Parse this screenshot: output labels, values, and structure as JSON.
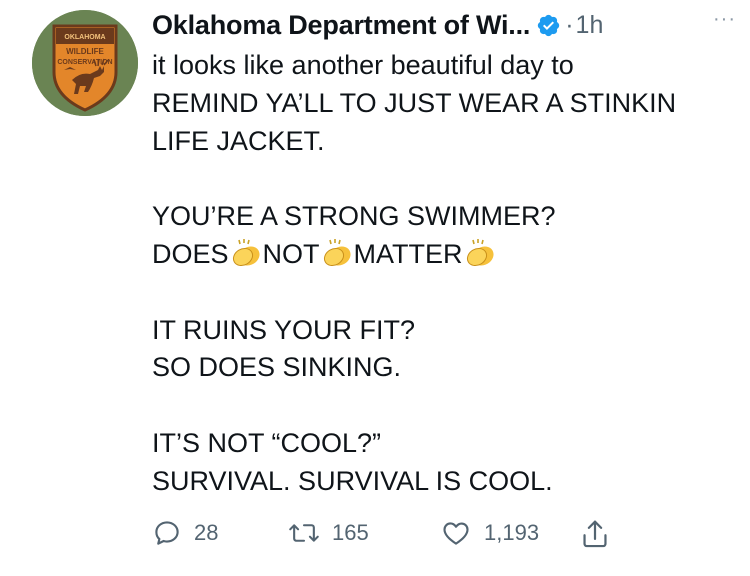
{
  "account": {
    "display_name": "Oklahoma Department of Wi...",
    "time_separator": "·",
    "timestamp": "1h",
    "more": "···",
    "avatar_text": [
      "OKLAHOMA",
      "WILDLIFE",
      "CONSERVATION"
    ]
  },
  "tweet": {
    "lines": [
      "it looks like another beautiful day to",
      "REMIND YA’LL TO JUST WEAR A STINKIN",
      "LIFE JACKET.",
      "YOU’RE A STRONG SWIMMER?",
      "IT RUINS YOUR FIT?",
      "SO DOES SINKING.",
      "IT’S NOT “COOL?”",
      "SURVIVAL. SURVIVAL IS COOL."
    ],
    "clap_words": [
      "DOES",
      "NOT",
      "MATTER"
    ],
    "emoji": "clapping-hands"
  },
  "actions": {
    "replies": "28",
    "retweets": "165",
    "likes": "1,193"
  },
  "colors": {
    "text": "#0f1419",
    "secondary": "#536471",
    "verified": "#1d9bf0",
    "avatar_bg": "#6a8453",
    "badge_orange": "#e3862a",
    "badge_brown": "#6b3a1c"
  }
}
